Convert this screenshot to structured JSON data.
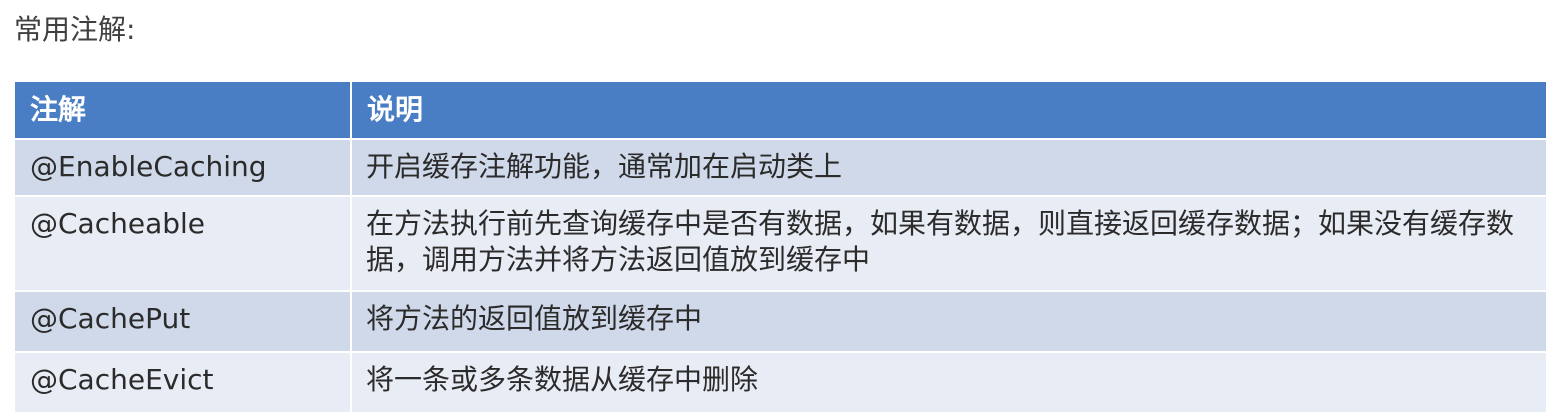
{
  "heading": "常用注解:",
  "table": {
    "headers": [
      "注解",
      "说明"
    ],
    "rows": [
      {
        "name": "@EnableCaching",
        "desc": "开启缓存注解功能，通常加在启动类上"
      },
      {
        "name": "@Cacheable",
        "desc": "在方法执行前先查询缓存中是否有数据，如果有数据，则直接返回缓存数据；如果没有缓存数据，调用方法并将方法返回值放到缓存中"
      },
      {
        "name": "@CachePut",
        "desc": "将方法的返回值放到缓存中"
      },
      {
        "name": "@CacheEvict",
        "desc": "将一条或多条数据从缓存中删除"
      }
    ]
  },
  "colors": {
    "header_bg": "#4a7ec4",
    "row_odd_bg": "#d0d9ea",
    "row_even_bg": "#e8ecf4"
  }
}
